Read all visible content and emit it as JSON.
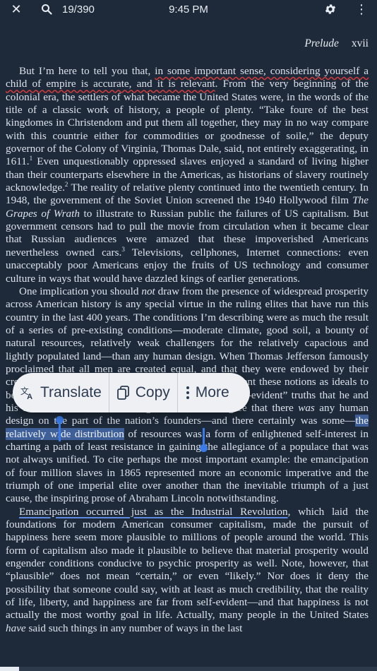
{
  "topbar": {
    "close_glyph": "✕",
    "location": "19/390",
    "time": "9:45 PM",
    "menu_glyph": "⋮"
  },
  "header": {
    "title": "Prelude",
    "page": "xvii"
  },
  "body": {
    "p1_a": "But I’m here to tell you that, ",
    "p1_wavy": "in some important sense, considering yourself a child of empire is accurate, and it is relevant",
    "p1_b": ". From the very beginning of the colonial era, the settlers of what became the United States were, in the words of the title of a classic work of history, a people of plenty. “Take foure of the best kingdomes in Christendom and put them all together, they may in no way compare with this countrie either for commodities or goodnesse of soile,” the deputy governor of the Colony of Virginia, Thomas Dale, said, not entirely exaggerating, in 1611.",
    "fn1": "1",
    "p1_c": " Even unquestionably oppressed slaves enjoyed a standard of living higher than their counterparts elsewhere in the Americas, as historians of slavery routinely acknowledge.",
    "fn2": "2",
    "p1_d": " The reality of relative plenty continued into the twentieth century. In 1948, the government of the Soviet Union screened the 1940 Hollywood film ",
    "p1_film": "The Grapes of Wrath",
    "p1_e": " to illustrate to Russian public the failures of US capitalism. But government censors had to pull the movie from circulation when it became clear that Russian audiences were amazed that these impoverished Americans nevertheless owned cars.",
    "fn3": "3",
    "p1_f": " Televisions, cellphones, Internet connections: even unacceptably poor Americans enjoy the fruits of US technology and consumer culture in ways that would have dazzled kings of earlier generations.",
    "p2_a": "One implication you should ",
    "p2_not": "not",
    "p2_b": " draw from the presence of widespread prosperity across American history is any special virtue in the ruling elites that have run this country in the last 400 years. The conditions I’m describing were as much the result of a series of pre-existing conditions—moderate climate, good soil, a bounty of natural resources, relatively weak challengers for the relatively capacious and lightly populated land—than any human design. When Thomas Jefferson famously proclaimed that all men are created equal, and that they were endowed by their creator with certain unalienable rights, he did not present these notions as ideals to be worked toward; he presented them as facts, as “self-evident” truths that he and his fellow Americans took for granted. To the degree that there ",
    "p2_was": "was",
    "p2_c": " any human design on the part of the nation’s founders—and there certainly was some—",
    "p2_sel": "the relatively wide distribution",
    "p2_d": " of resources was a form of enlightened self-interest in charting a path of least resistance in gaining the allegiance of a populace that was not always unified. To cite perhaps the most important example: the emancipation of four million slaves in 1865 represented more an economic imperative and the triumph of one imperial elite over another than the inevitable triumph of a just cause, the inspiring prose of Abraham Lincoln notwithstanding.",
    "p3_ul": "Emancipation occurred just as the Industrial Revolution",
    "p3_a": ", which laid the foundations for modern American consumer capitalism, made the pursuit of happiness here seem more plausible to millions of people around the world. This form of capitalism also made it plausible to believe that material prosperity would engender conditions conducive to psychic prosperity as well. Note, however, that “plausible” does not mean “certain,” or even “likely.” Nor does it deny the possibility that someone could say, with at least as much credibility, that the reality of life, liberty, and happiness are far from self-evident—and that happiness is not actually the most worthy goal in life. Actually, many people in the United States ",
    "p3_have": "have",
    "p3_b": " said such things in any number of ways in the last"
  },
  "popup": {
    "translate": "Translate",
    "copy": "Copy",
    "more": "More"
  },
  "progress": {
    "fraction": 0.05
  }
}
